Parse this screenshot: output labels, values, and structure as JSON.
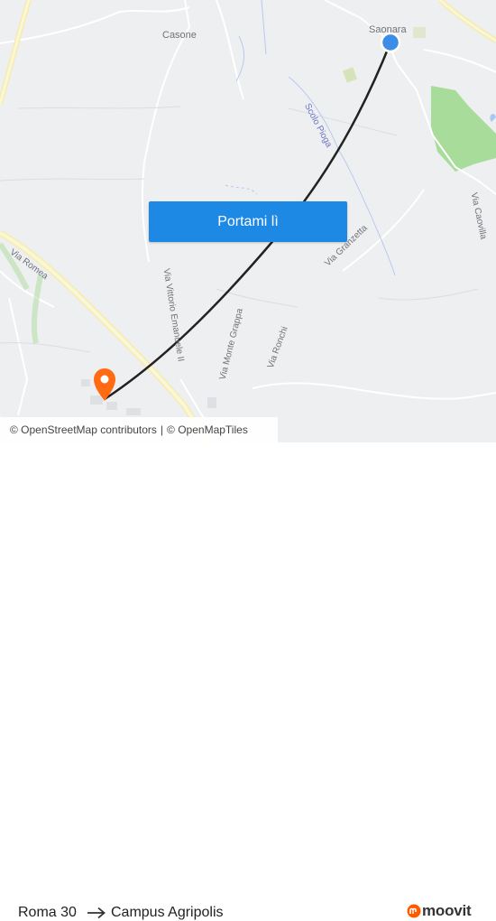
{
  "map": {
    "places": [
      "Casone",
      "Saonara"
    ],
    "streets": {
      "via_romea": "Via Romea",
      "via_vittorio_emanuele": "Via Vittorio Emanuele II",
      "via_monte_grappa": "Via Monte Grappa",
      "via_ronchi": "Via Ronchi",
      "via_granzetta": "Via Granzetta",
      "via_cavour": "Via Caovilla"
    },
    "waterways": {
      "scolo_pioga": "Scolo Pioga"
    },
    "colors": {
      "background": "#eeeff0",
      "park": "#a8dc9a",
      "route_line": "#222222",
      "origin_marker": "#3d8ce8",
      "destination_marker": "#ff6a13",
      "button": "#1e88e5"
    }
  },
  "action": {
    "label": "Portami lì"
  },
  "attribution": {
    "osm": "© OpenStreetMap contributors",
    "omt": "© OpenMapTiles",
    "separator": "|"
  },
  "route": {
    "origin": "Roma 30",
    "arrow_icon": "arrow-right-icon",
    "destination": "Campus Agripolis"
  },
  "brand": {
    "name": "moovit",
    "color": "#ff5a00"
  }
}
